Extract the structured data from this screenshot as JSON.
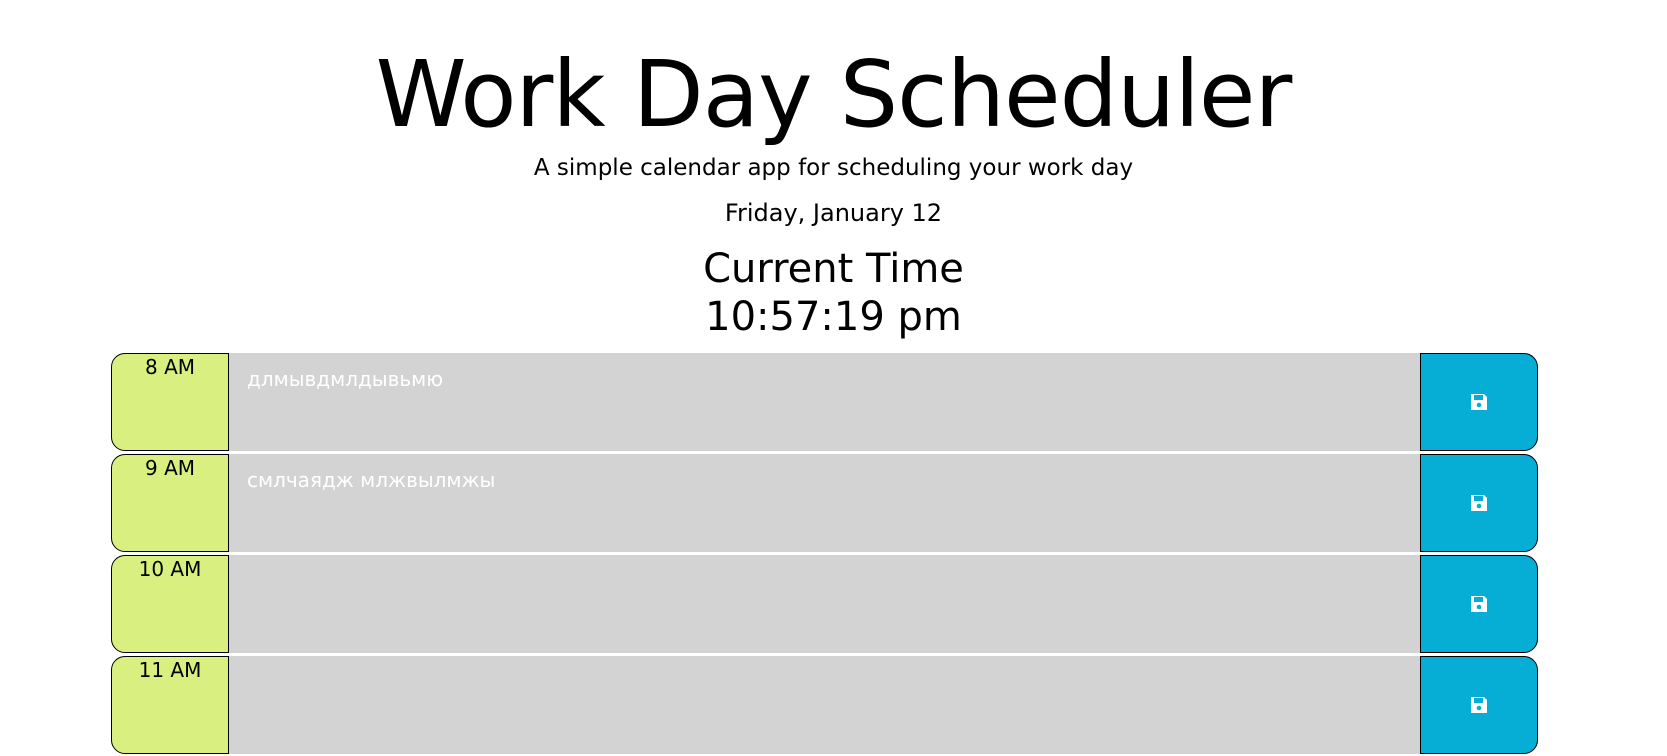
{
  "header": {
    "title": "Work Day Scheduler",
    "subtitle": "A simple calendar app for scheduling your work day",
    "date": "Friday, January 12",
    "clock_label": "Current Time",
    "clock_value": "10:57:19 pm"
  },
  "colors": {
    "hour_bg": "#d9ef80",
    "past_bg": "#d3d3d3",
    "save_bg": "#06aed5"
  },
  "schedule": [
    {
      "hour": "8 AM",
      "text": "длмывдмлдывьмю",
      "save_icon": "save-icon"
    },
    {
      "hour": "9 AM",
      "text": "смлчаядж млжвылмжы",
      "save_icon": "save-icon"
    },
    {
      "hour": "10 AM",
      "text": "",
      "save_icon": "save-icon"
    },
    {
      "hour": "11 AM",
      "text": "",
      "save_icon": "save-icon"
    }
  ]
}
